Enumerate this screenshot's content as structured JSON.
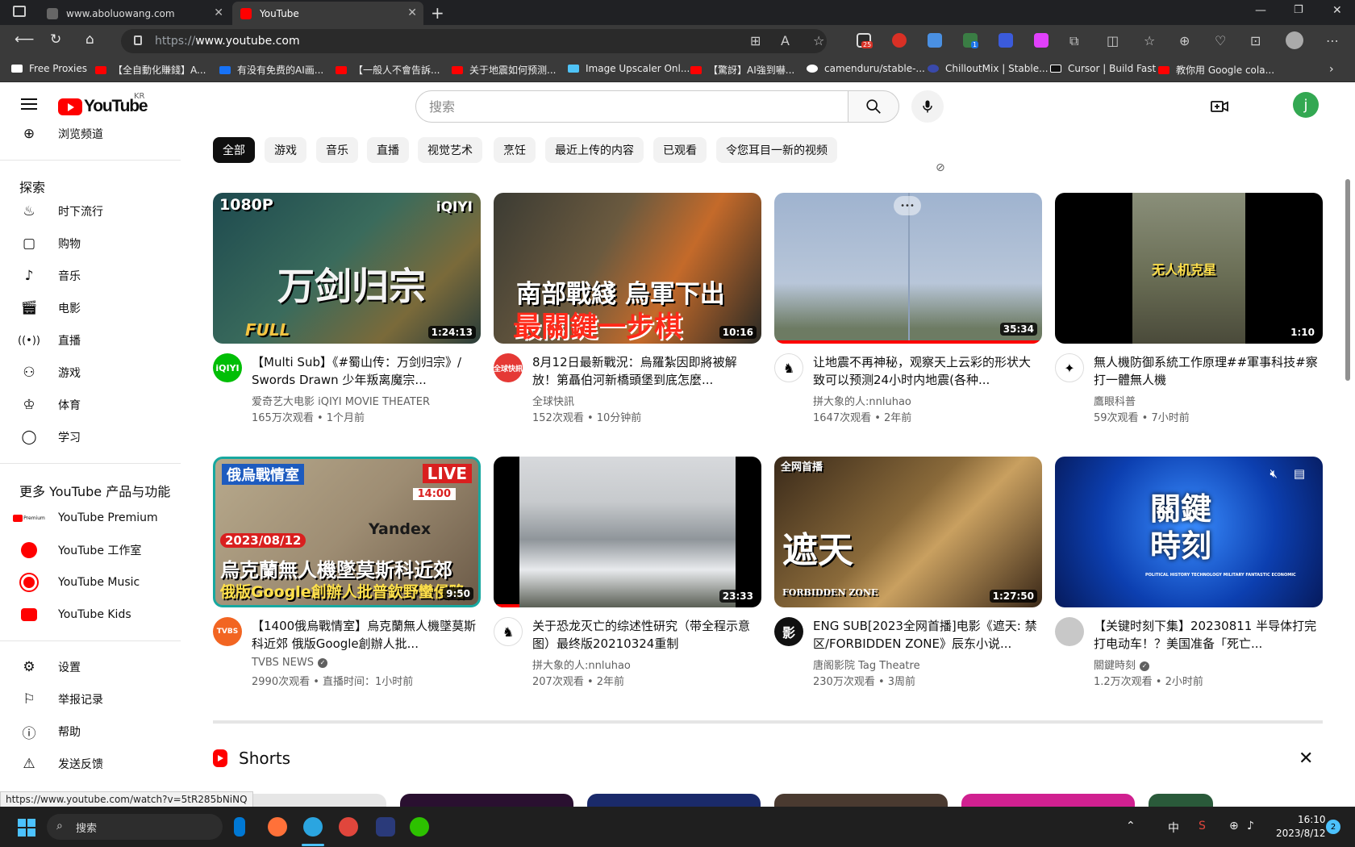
{
  "browser": {
    "tabs": [
      {
        "title": "www.aboluowang.com"
      },
      {
        "title": "YouTube"
      }
    ],
    "new_tab": "+",
    "url_proto": "https://",
    "url_host": "www.youtube.com",
    "bookmarks": [
      "Free Proxies",
      "【全自動化賺錢】A...",
      "有没有免费的AI画...",
      "【一般人不會告訴...",
      "关于地震如何预测...",
      "Image Upscaler Onl...",
      "【驚訝】AI強到嚇...",
      "camenduru/stable-...",
      "ChilloutMix | Stable...",
      "Cursor | Build Fast",
      "教你用 Google cola..."
    ],
    "ext_badges": {
      "mail": "25",
      "green": "1"
    }
  },
  "youtube": {
    "logo_text": "YouTube",
    "country": "KR",
    "search_placeholder": "搜索",
    "avatar_letter": "j",
    "sidebar": {
      "browse_channels": "浏览频道",
      "explore_title": "探索",
      "explore": [
        {
          "label": "时下流行",
          "icon": "flame-icon"
        },
        {
          "label": "购物",
          "icon": "shopping-bag-icon"
        },
        {
          "label": "音乐",
          "icon": "music-note-icon"
        },
        {
          "label": "电影",
          "icon": "clapperboard-icon"
        },
        {
          "label": "直播",
          "icon": "live-broadcast-icon"
        },
        {
          "label": "游戏",
          "icon": "gamepad-icon"
        },
        {
          "label": "体育",
          "icon": "trophy-icon"
        },
        {
          "label": "学习",
          "icon": "lightbulb-icon"
        }
      ],
      "more_title": "更多 YouTube 产品与功能",
      "more": [
        {
          "label": "YouTube Premium"
        },
        {
          "label": "YouTube 工作室"
        },
        {
          "label": "YouTube Music"
        },
        {
          "label": "YouTube Kids"
        }
      ],
      "settings": [
        {
          "label": "设置",
          "icon": "gear-icon"
        },
        {
          "label": "举报记录",
          "icon": "flag-icon"
        },
        {
          "label": "帮助",
          "icon": "help-icon"
        },
        {
          "label": "发送反馈",
          "icon": "feedback-icon"
        }
      ],
      "premium_badge": "Premium"
    },
    "chips": [
      "全部",
      "游戏",
      "音乐",
      "直播",
      "视觉艺术",
      "烹饪",
      "最近上传的内容",
      "已观看",
      "令您耳目一新的视频"
    ],
    "videos": [
      {
        "title": "【Multi Sub】《#蜀山传：万剑归宗》/ Swords Drawn 少年叛离魔宗...",
        "channel": "爱奇艺大电影 iQIYI MOVIE THEATER",
        "meta": "165万次观看 • 1个月前",
        "duration": "1:24:13",
        "avatar_text": "iQIYI",
        "overlay_top": "1080P",
        "overlay_brand": "iQIYI",
        "overlay_main": "万剑归宗",
        "overlay_bottom": "FULL"
      },
      {
        "title": "8月12日最新戰況：烏羅紮因即將被解放！第聶伯河新橋頭堡到底怎麼...",
        "channel": "全球快訊",
        "meta": "152次观看 • 10分钟前",
        "duration": "10:16",
        "avatar_text": "全球快訊",
        "overlay_line1": "南部戰綫 烏軍下出",
        "overlay_line2": "最關鍵一步棋"
      },
      {
        "title": "让地震不再神秘，观察天上云彩的形状大致可以预测24小时内地震(各种...",
        "channel": "拼大象的人:nnluhao",
        "meta": "1647次观看 • 2年前",
        "duration": "35:34",
        "avatar_text": "",
        "more_dots": "•••"
      },
      {
        "title": "無人機防御系統工作原理##軍事科技#察打一體無人機",
        "channel": "鷹眼科普",
        "meta": "59次观看 • 7小时前",
        "duration": "1:10",
        "avatar_text": "",
        "overlay_main": "无人机克星"
      },
      {
        "title": "【1400俄烏戰情室】烏克蘭無人機墜莫斯科近郊 俄版Google創辦人批...",
        "channel": "TVBS NEWS",
        "meta": "2990次观看 • 直播时间：1小时前",
        "duration": "9:50",
        "avatar_text": "TVBS",
        "verified": true,
        "overlay_tag": "俄烏戰情室",
        "overlay_live": "LIVE",
        "overlay_time": "14:00",
        "overlay_date": "2023/08/12",
        "overlay_line1": "烏克蘭無人機墜莫斯科近郊",
        "overlay_line2": "俄版Google創辦人批普欽野蠻侵略",
        "overlay_yandex": "Yandex"
      },
      {
        "title": "关于恐龙灭亡的综述性研究（带全程示意图）最终版20210324重制",
        "channel": "拼大象的人:nnluhao",
        "meta": "207次观看 • 2年前",
        "duration": "23:33",
        "avatar_text": ""
      },
      {
        "title": "ENG SUB[2023全网首播]电影《遮天: 禁区/FORBIDDEN ZONE》辰东小说...",
        "channel": "唐阁影院 Tag Theatre",
        "meta": "230万次观看 • 3周前",
        "duration": "1:27:50",
        "avatar_text": "影",
        "overlay_tag": "全网首播",
        "overlay_main": "遮天",
        "overlay_bottom": "FORBIDDEN ZONE"
      },
      {
        "title": "【关键时刻下集】20230811 半导体打完打电动车！？美国准备「死亡...",
        "channel": "關鍵時刻",
        "meta": "1.2万次观看 • 2小时前",
        "duration": "",
        "avatar_text": "",
        "verified": true,
        "overlay_main": "關鍵時刻",
        "overlay_sub": "POLITICAL HISTORY TECHNOLOGY MILITARY FANTASTIC ECONOMIC"
      }
    ],
    "shorts_title": "Shorts"
  },
  "status_url": "https://www.youtube.com/watch?v=5tR285bNiNQ",
  "taskbar": {
    "search": "搜索",
    "ime": "中",
    "time": "16:10",
    "date": "2023/8/12",
    "notifications": "2"
  }
}
